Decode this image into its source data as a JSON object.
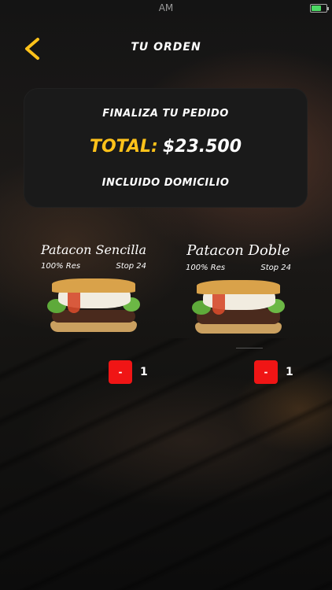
{
  "status": {
    "time": "AM"
  },
  "header": {
    "title": "TU ORDEN",
    "back_icon": "chevron-left-icon",
    "accent_color": "#ffc21a"
  },
  "summary": {
    "heading": "FINALIZA TU PEDIDO",
    "total_label": "TOTAL:",
    "total_value": "$23.500",
    "note": "INCLUIDO DOMICILIO"
  },
  "products": [
    {
      "name": "Patacon Sencilla",
      "tag_left": "100% Res",
      "tag_right": "Stop 24",
      "quantity": "1",
      "minus_label": "-"
    },
    {
      "name": "Patacon Doble",
      "tag_left": "100% Res",
      "tag_right": "Stop 24",
      "quantity": "1",
      "minus_label": "-"
    }
  ],
  "colors": {
    "minus_button": "#f01515",
    "battery": "#4cd964"
  }
}
